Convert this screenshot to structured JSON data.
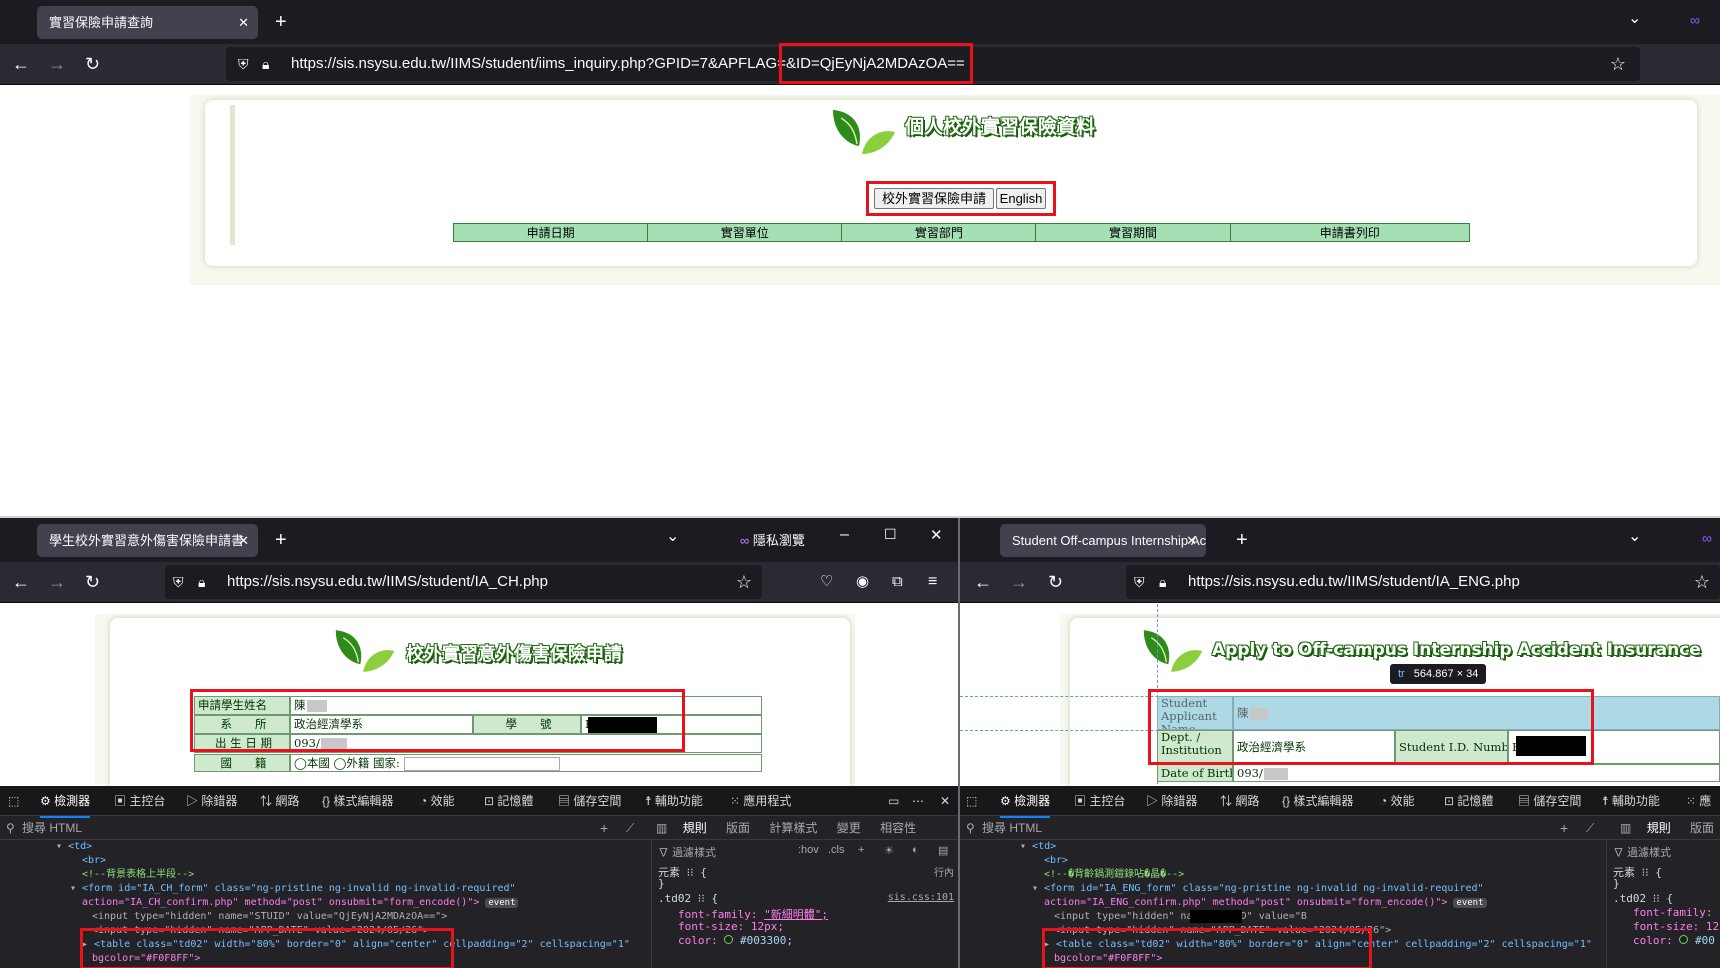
{
  "top": {
    "tab_title": "實習保險申請查詢",
    "url": "https://sis.nsysu.edu.tw/IIMS/student/iims_inquiry.php?GPID=7&APFLAG=&ID=QjEyNjA2MDAzOA==",
    "title": "個人校外實習保險資料",
    "btn_apply": "校外實習保險申請",
    "btn_english": "English",
    "headers": [
      "申請日期",
      "實習單位",
      "實習部門",
      "實習期間",
      "申請書列印"
    ]
  },
  "left": {
    "tab_title": "學生校外實習意外傷害保險申請書",
    "private_label": "隱私瀏覽",
    "url": "https://sis.nsysu.edu.tw/IIMS/student/IA_CH.php",
    "title": "校外實習意外傷害保險申請",
    "form": {
      "name_label": "申請學生姓名",
      "name_value": "陳",
      "dept_label": "系　　所",
      "dept_value": "政治經濟學系",
      "id_label": "學　　號",
      "id_value": "B",
      "dob_label": "出 生 日 期",
      "dob_value": "093/",
      "nation_label": "國　　籍",
      "nation_opt1": "本國",
      "nation_opt2": "外籍 國家:"
    },
    "devtools": {
      "tabs": [
        "檢測器",
        "主控台",
        "除錯器",
        "網路",
        "樣式編輯器",
        "效能",
        "記憶體",
        "儲存空間",
        "輔助功能",
        "應用程式"
      ],
      "search_placeholder": "搜尋 HTML",
      "right_tabs": [
        "規則",
        "版面",
        "計算樣式",
        "變更",
        "相容性"
      ],
      "filter": "過濾樣式",
      "hov": ":hov",
      "cls": ".cls",
      "code": [
        "<td>",
        "<br>",
        "<!--背景表格上半段-->",
        "<form id=\"IA_CH_form\" class=\"ng-pristine ng-invalid ng-invalid-required\"",
        "action=\"IA_CH_confirm.php\" method=\"post\" onsubmit=\"form_encode()\">",
        "<input type=\"hidden\" name=\"STUID\" value=\"QjEyNjA2MDAzOA==\">",
        "<input type=\"hidden\" name=\"APP_DATE\" value=\"2024/05/26\">",
        "<table class=\"td02\" width=\"80%\" border=\"0\" align=\"center\" cellpadding=\"2\" cellspacing=\"1\"",
        "bgcolor=\"#F0F8FF\">"
      ],
      "event": "event",
      "rules": {
        "element": "元素 ⁝⁝ {",
        "inline": "行內",
        "close": "}",
        "sel": ".td02 ⁝⁝ {",
        "src": "sis.css:101",
        "ff_k": "font-family:",
        "ff_v": "\"新細明體\";",
        "fs": "font-size: 12px;",
        "col_k": "color:",
        "col_v": "#003300;"
      }
    }
  },
  "right": {
    "tab_title": "Student Off-campus Internship Ac",
    "url": "https://sis.nsysu.edu.tw/IIMS/student/IA_ENG.php",
    "title": "Apply to Off-campus Internship Accident Insurance",
    "tooltip_tag": "tr",
    "tooltip_size": "564.867 × 34",
    "form": {
      "name_label_1": "Student",
      "name_label_2": "Applicant Name",
      "name_value": "陳",
      "dept_label_1": "Dept. /",
      "dept_label_2": "Institution",
      "dept_value": "政治經濟學系",
      "id_label": "Student I.D. Number",
      "id_value": "B",
      "dob_label": "Date of Birth",
      "dob_value": "093/"
    },
    "devtools": {
      "tabs": [
        "檢測器",
        "主控台",
        "除錯器",
        "網路",
        "樣式編輯器",
        "效能",
        "記憶體",
        "儲存空間",
        "輔助功能",
        "應"
      ],
      "search_placeholder": "搜尋 HTML",
      "right_tabs": [
        "規則",
        "版面"
      ],
      "filter": "過濾樣式",
      "code": [
        "<td>",
        "<br>",
        "<!--�背齡鍋測鎧錄呫�晶�-->",
        "<form id=\"IA_ENG_form\" class=\"ng-pristine ng-invalid ng-invalid-required\"",
        "action=\"IA_ENG_confirm.php\" method=\"post\" onsubmit=\"form_encode()\">",
        "<input type=\"hidden\" name=\"STUID\" value=\"B",
        "<input type=\"hidden\" name=\"APP_DATE\" value=\"2024/05/26\">",
        "<table class=\"td02\" width=\"80%\" border=\"0\" align=\"center\" cellpadding=\"2\" cellspacing=\"1\"",
        "bgcolor=\"#F0F8FF\">"
      ],
      "event": "event",
      "rules": {
        "element": "元素 ⁝⁝ {",
        "close": "}",
        "sel": ".td02 ⁝⁝ {",
        "ff_k": "font-family:",
        "fs": "font-size: 12",
        "col_k": "color:",
        "col_v": "#00"
      }
    }
  }
}
